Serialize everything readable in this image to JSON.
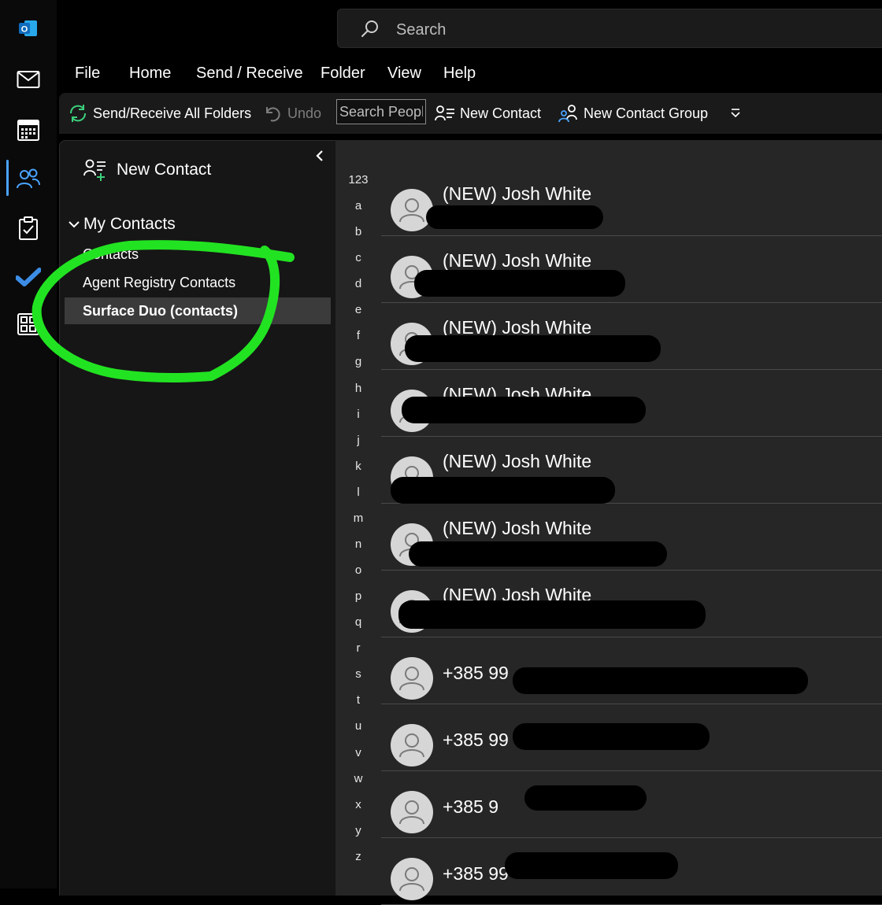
{
  "app": {
    "brand_color": "#0f6cbd",
    "accent_color": "#4aa3ff",
    "annotation_color": "#22e322"
  },
  "rail": {
    "icons": [
      "outlook-logo-icon",
      "mail-icon",
      "calendar-icon",
      "people-icon",
      "tasks-icon",
      "todo-icon",
      "apps-icon"
    ]
  },
  "search": {
    "placeholder": "Search"
  },
  "menu": {
    "items": [
      "File",
      "Home",
      "Send / Receive",
      "Folder",
      "View",
      "Help"
    ]
  },
  "ribbon": {
    "send_receive_all": "Send/Receive All Folders",
    "undo": "Undo",
    "search_people_placeholder": "Search People",
    "new_contact": "New Contact",
    "new_contact_group": "New Contact Group"
  },
  "folder_pane": {
    "new_contact": "New Contact",
    "group_label": "My Contacts",
    "folders": [
      {
        "label": "Contacts",
        "selected": false
      },
      {
        "label": "Agent Registry Contacts",
        "selected": false
      },
      {
        "label": "Surface Duo (contacts)",
        "selected": true
      }
    ]
  },
  "alphabet": [
    "123",
    "a",
    "b",
    "c",
    "d",
    "e",
    "f",
    "g",
    "h",
    "i",
    "j",
    "k",
    "l",
    "m",
    "n",
    "o",
    "p",
    "q",
    "r",
    "s",
    "t",
    "u",
    "v",
    "w",
    "x",
    "y",
    "z"
  ],
  "contacts": [
    {
      "name": "(NEW) Josh White"
    },
    {
      "name": "(NEW) Josh White"
    },
    {
      "name": "(NEW) Josh White"
    },
    {
      "name": "(NEW) Josh White"
    },
    {
      "name": "(NEW) Josh White"
    },
    {
      "name": "(NEW) Josh White"
    },
    {
      "name": "(NEW) Josh White"
    },
    {
      "name": "+385 99"
    },
    {
      "name": "+385 99"
    },
    {
      "name": "+385 9"
    },
    {
      "name": "+385 99"
    }
  ]
}
